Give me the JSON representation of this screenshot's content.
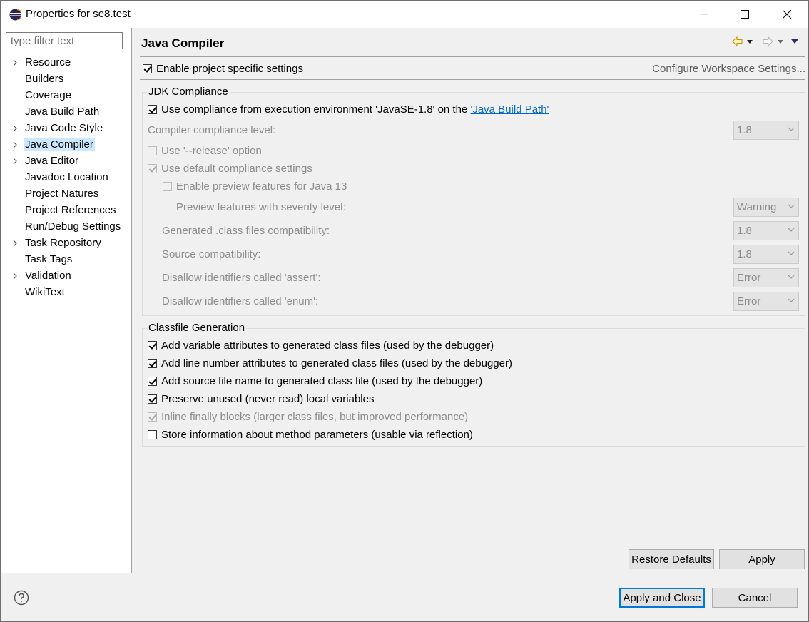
{
  "window": {
    "title": "Properties for se8.test"
  },
  "sidebar": {
    "filter_placeholder": "type filter text",
    "items": [
      {
        "label": "Resource",
        "expandable": true
      },
      {
        "label": "Builders",
        "expandable": false
      },
      {
        "label": "Coverage",
        "expandable": false
      },
      {
        "label": "Java Build Path",
        "expandable": false
      },
      {
        "label": "Java Code Style",
        "expandable": true
      },
      {
        "label": "Java Compiler",
        "expandable": true,
        "selected": true
      },
      {
        "label": "Java Editor",
        "expandable": true
      },
      {
        "label": "Javadoc Location",
        "expandable": false
      },
      {
        "label": "Project Natures",
        "expandable": false
      },
      {
        "label": "Project References",
        "expandable": false
      },
      {
        "label": "Run/Debug Settings",
        "expandable": false
      },
      {
        "label": "Task Repository",
        "expandable": true
      },
      {
        "label": "Task Tags",
        "expandable": false
      },
      {
        "label": "Validation",
        "expandable": true
      },
      {
        "label": "WikiText",
        "expandable": false
      }
    ]
  },
  "main": {
    "title": "Java Compiler",
    "enable_project_specific": {
      "label": "Enable project specific settings",
      "checked": true
    },
    "configure_workspace_link": "Configure Workspace Settings...",
    "jdk": {
      "group_title": "JDK Compliance",
      "use_compliance_prefix": "Use compliance from execution environment 'JavaSE-1.8' on the ",
      "use_compliance_link": "'Java Build Path'",
      "use_compliance_checked": true,
      "compiler_level_label": "Compiler compliance level:",
      "compiler_level_value": "1.8",
      "release_option_label": "Use '--release' option",
      "default_settings_label": "Use default compliance settings",
      "preview_label": "Enable preview features for Java 13",
      "preview_severity_label": "Preview features with severity level:",
      "preview_severity_value": "Warning",
      "generated_compat_label": "Generated .class files compatibility:",
      "generated_compat_value": "1.8",
      "source_compat_label": "Source compatibility:",
      "source_compat_value": "1.8",
      "assert_label": "Disallow identifiers called 'assert':",
      "assert_value": "Error",
      "enum_label": "Disallow identifiers called 'enum':",
      "enum_value": "Error"
    },
    "classfile": {
      "group_title": "Classfile Generation",
      "options": [
        {
          "label": "Add variable attributes to generated class files (used by the debugger)",
          "checked": true,
          "disabled": false
        },
        {
          "label": "Add line number attributes to generated class files (used by the debugger)",
          "checked": true,
          "disabled": false
        },
        {
          "label": "Add source file name to generated class file (used by the debugger)",
          "checked": true,
          "disabled": false
        },
        {
          "label": "Preserve unused (never read) local variables",
          "checked": true,
          "disabled": false
        },
        {
          "label": "Inline finally blocks (larger class files, but improved performance)",
          "checked": true,
          "disabled": true
        },
        {
          "label": "Store information about method parameters (usable via reflection)",
          "checked": false,
          "disabled": false
        }
      ]
    },
    "restore_defaults_label": "Restore Defaults",
    "apply_label": "Apply"
  },
  "footer": {
    "apply_close_label": "Apply and Close",
    "cancel_label": "Cancel"
  },
  "colors": {
    "selection": "#cce8ff",
    "accent": "#0078d7",
    "link": "#0066cc"
  }
}
